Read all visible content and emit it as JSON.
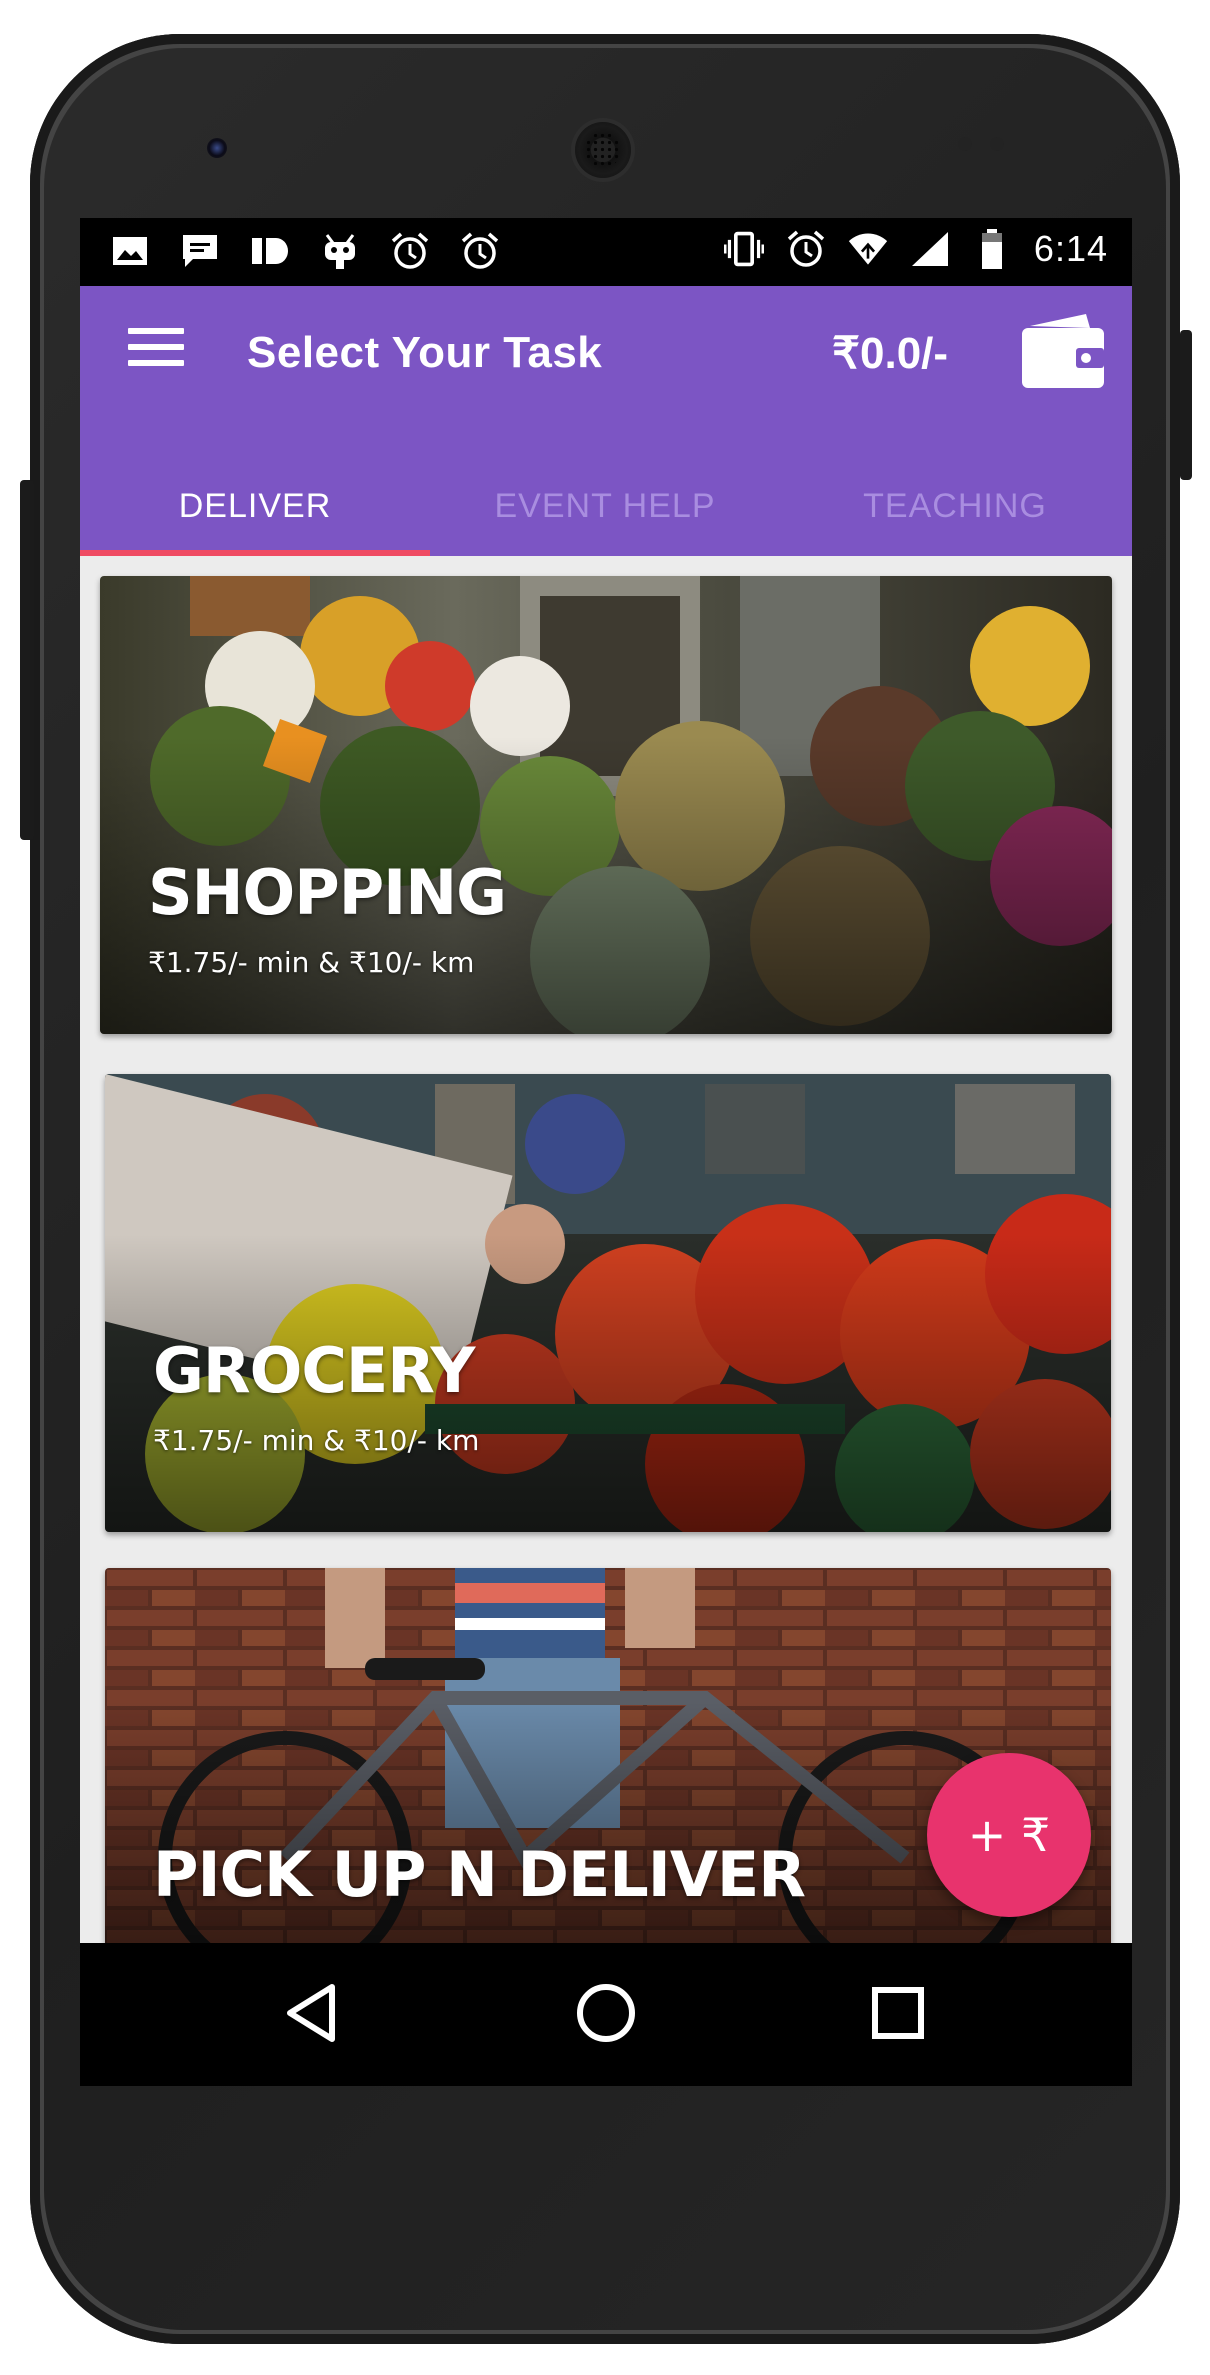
{
  "status_bar": {
    "time": "6:14",
    "left_icons": [
      "image-icon",
      "chat-icon",
      "id-icon",
      "android-icon",
      "alarm-icon",
      "alarm-icon"
    ],
    "right_icons": [
      "vibrate-icon",
      "alarm-icon",
      "wifi-icon",
      "signal-icon",
      "battery-icon"
    ]
  },
  "app_bar": {
    "title": "Select Your Task",
    "balance": "₹0.0/-",
    "menu_icon": "hamburger-menu-icon",
    "wallet_icon": "wallet-icon",
    "color": "#7c55c4"
  },
  "tabs": [
    {
      "label": "DELIVER",
      "active": true
    },
    {
      "label": "EVENT HELP",
      "active": false
    },
    {
      "label": "TEACHING",
      "active": false
    }
  ],
  "tab_indicator_color": "#ef4b63",
  "cards": [
    {
      "title": "SHOPPING",
      "price": "₹1.75/- min & ₹10/- km"
    },
    {
      "title": "GROCERY",
      "price": "₹1.75/- min & ₹10/- km"
    },
    {
      "title": "PICK UP N DELIVER",
      "price": ""
    }
  ],
  "fab": {
    "label": "+ ₹",
    "color": "#e8336d"
  },
  "nav_bar": {
    "icons": [
      "back-icon",
      "home-icon",
      "recents-icon"
    ]
  }
}
